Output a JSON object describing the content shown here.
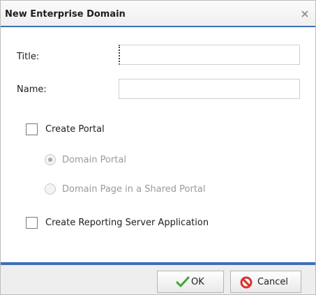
{
  "dialog": {
    "title": "New Enterprise Domain",
    "close_icon": "close-x-icon"
  },
  "form": {
    "title_label": "Title:",
    "title_value": "",
    "name_label": "Name:",
    "name_value": "",
    "create_portal": {
      "label": "Create Portal",
      "checked": false
    },
    "portal_options": [
      {
        "label": "Domain Portal",
        "selected": true,
        "enabled": false
      },
      {
        "label": "Domain Page in a Shared Portal",
        "selected": false,
        "enabled": false
      }
    ],
    "create_rs_app": {
      "label": "Create Reporting Server Application",
      "checked": false
    }
  },
  "buttons": {
    "ok_label": "OK",
    "ok_icon": "checkmark-icon",
    "cancel_label": "Cancel",
    "cancel_icon": "cancel-icon"
  },
  "colors": {
    "accent": "#3d6fb6",
    "ok_green": "#3fa535",
    "cancel_red": "#d8322c"
  }
}
